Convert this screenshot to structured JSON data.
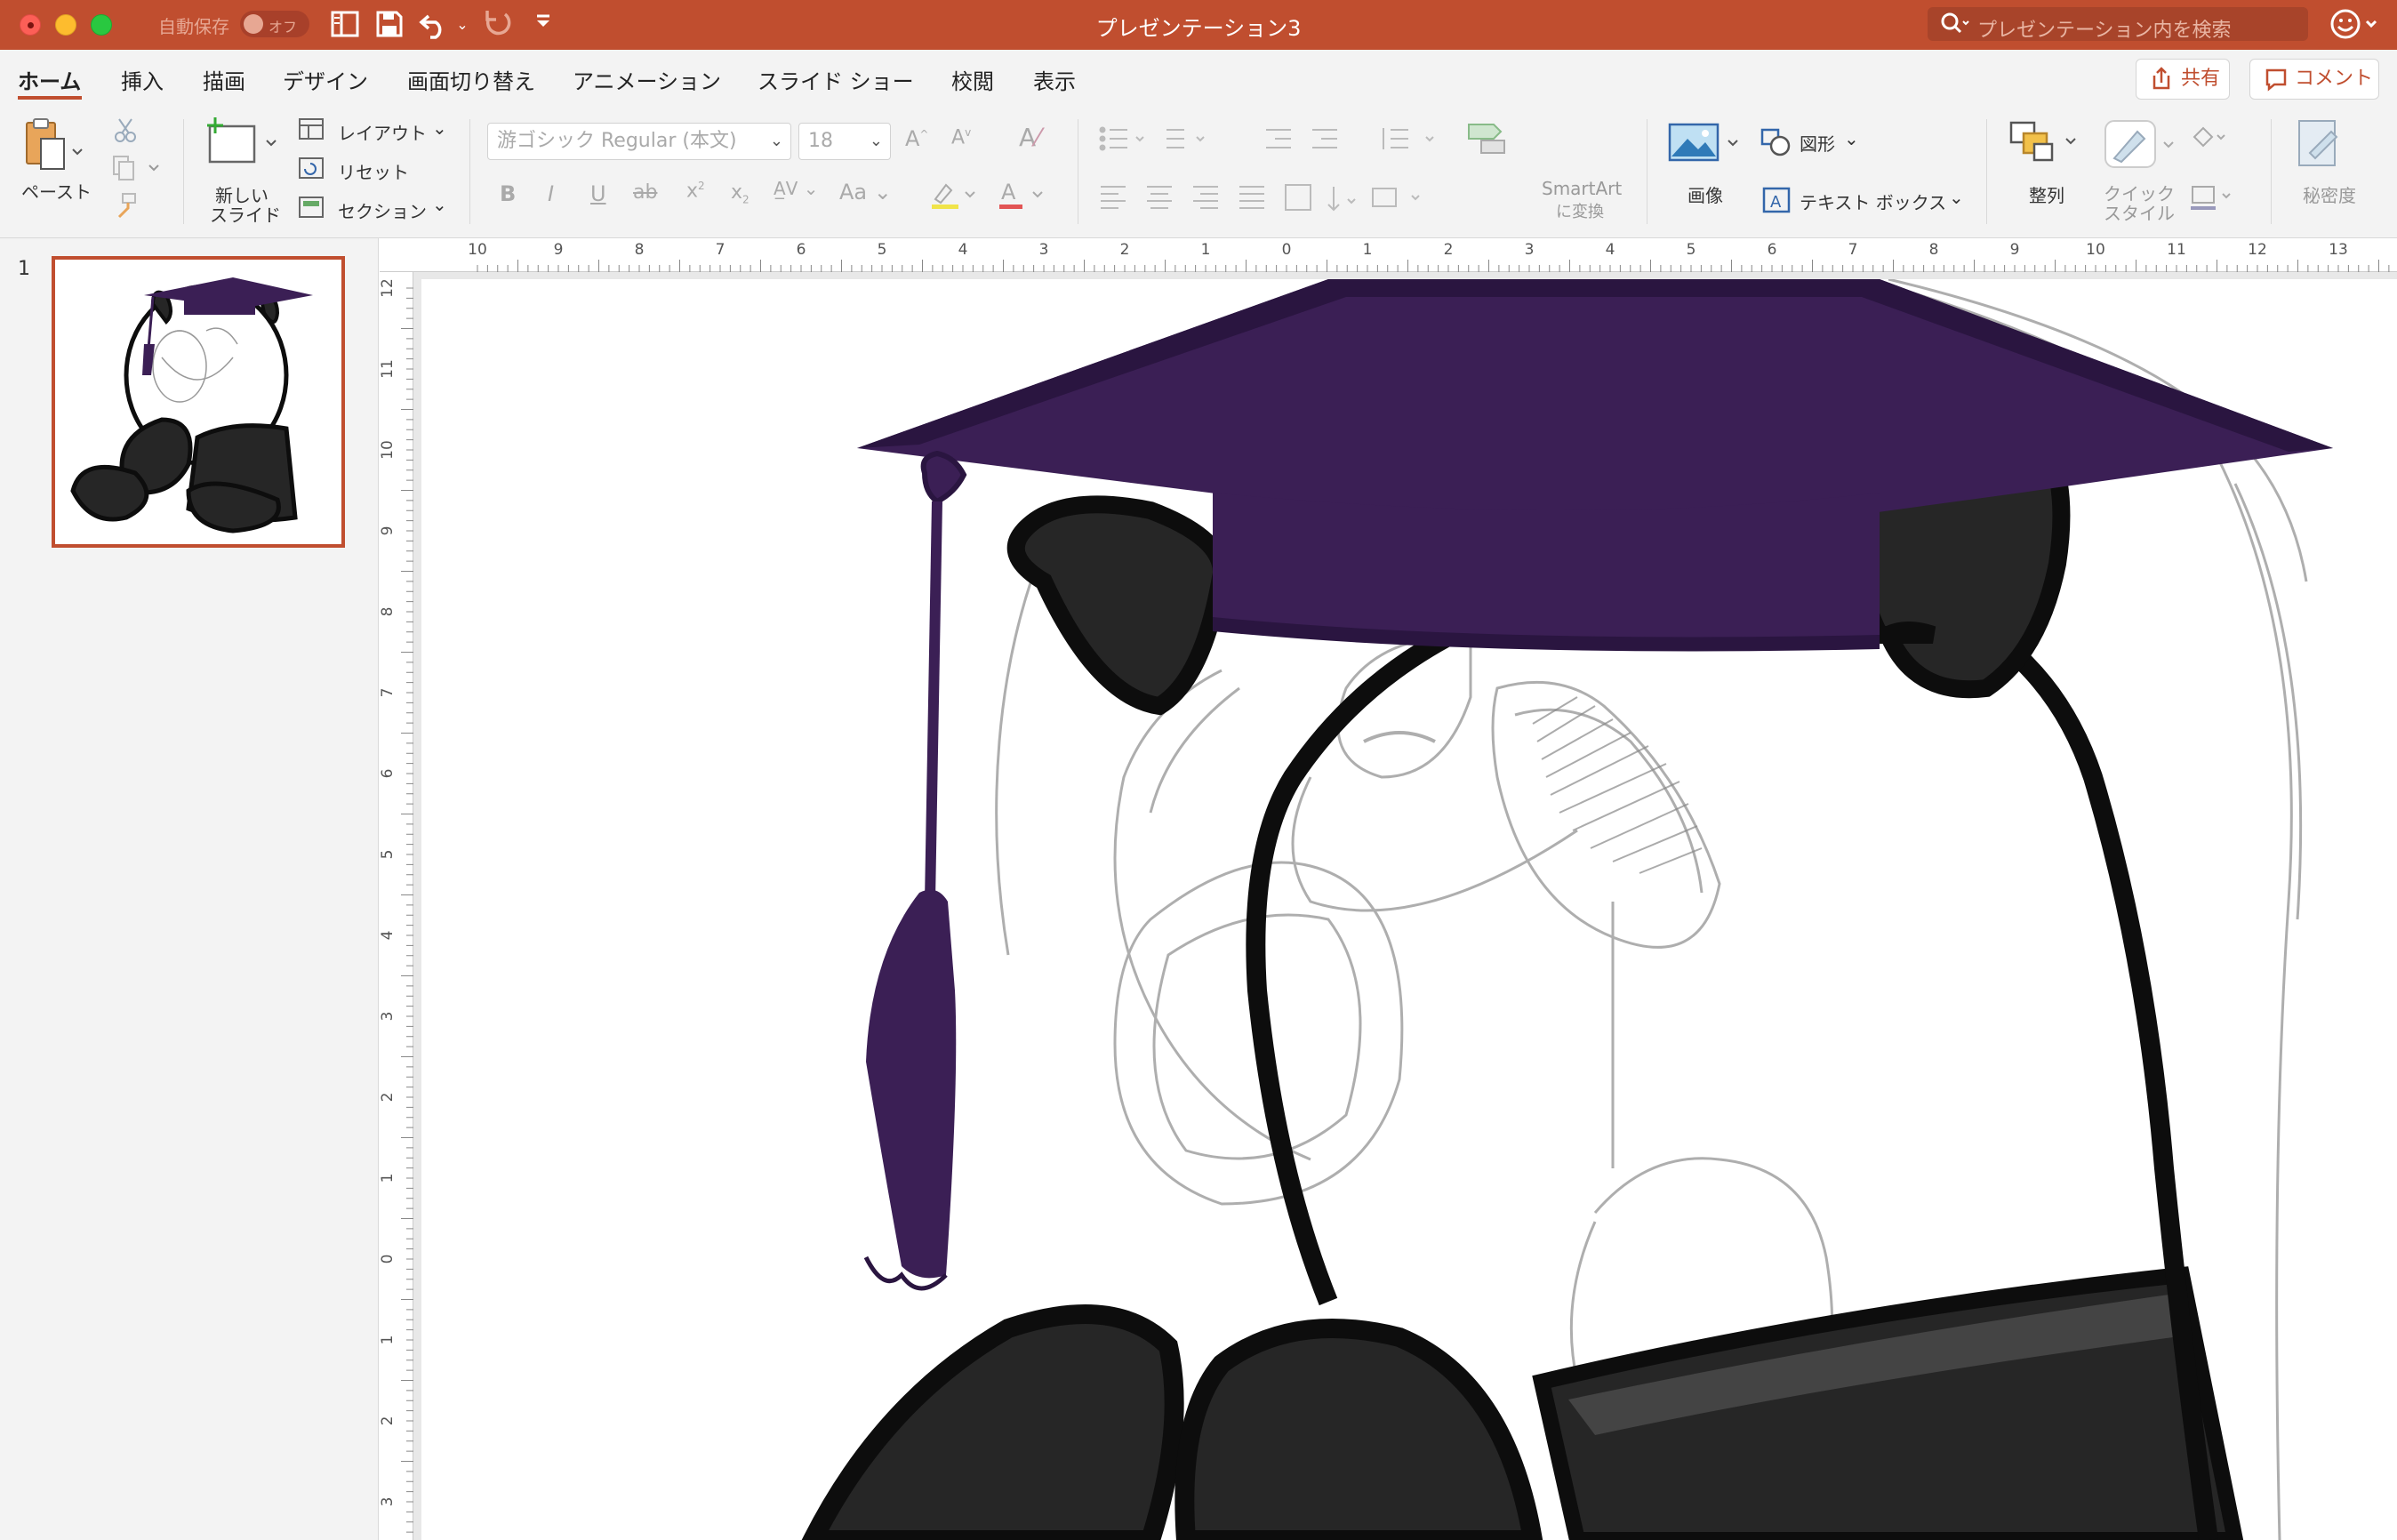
{
  "window": {
    "title": "プレゼンテーション3",
    "autosave_label": "自動保存",
    "autosave_state": "オフ",
    "search_placeholder": "プレゼンテーション内を検索"
  },
  "tabs": [
    {
      "label": "ホーム",
      "active": true
    },
    {
      "label": "挿入"
    },
    {
      "label": "描画"
    },
    {
      "label": "デザイン"
    },
    {
      "label": "画面切り替え"
    },
    {
      "label": "アニメーション"
    },
    {
      "label": "スライド ショー"
    },
    {
      "label": "校閲"
    },
    {
      "label": "表示"
    }
  ],
  "actions": {
    "share": "共有",
    "comment": "コメント"
  },
  "ribbon": {
    "paste": "ペースト",
    "new_slide_1": "新しい",
    "new_slide_2": "スライド",
    "layout": "レイアウト",
    "reset": "リセット",
    "section": "セクション",
    "font_name": "游ゴシック Regular (本文)",
    "font_size": "18",
    "smartart_1": "SmartArt",
    "smartart_2": "に変換",
    "picture": "画像",
    "shapes": "図形",
    "textbox": "テキスト ボックス",
    "arrange": "整列",
    "quick_style_1": "クイック",
    "quick_style_2": "スタイル",
    "sensitivity": "秘密度"
  },
  "slides": [
    {
      "number": "1"
    }
  ],
  "ruler": {
    "horizontal": [
      "10",
      "9",
      "8",
      "7",
      "6",
      "5",
      "4",
      "3",
      "2",
      "1",
      "0",
      "1",
      "2",
      "3",
      "4",
      "5",
      "6",
      "7",
      "8",
      "9",
      "10",
      "11",
      "12",
      "13"
    ],
    "vertical": [
      "12",
      "11",
      "10",
      "9",
      "8",
      "7",
      "6",
      "5",
      "4",
      "3",
      "2",
      "1",
      "0",
      "1",
      "2",
      "3"
    ]
  },
  "colors": {
    "accent": "#c04e2f",
    "cap": "#3b1f55",
    "cap_dark": "#2a1540",
    "ink": "#0d0d0d",
    "fur": "#262626"
  }
}
